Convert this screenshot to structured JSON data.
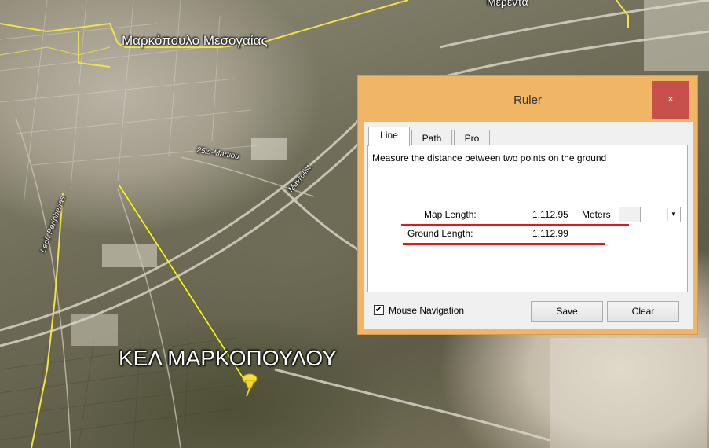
{
  "map": {
    "town_label": "Μαρκόπουλο Μεσογαίας",
    "place_label": "Μερέντα",
    "marker_label": "ΚΕΛ ΜΑΡΚΟΠΟΥΛΟΥ",
    "street_1": "25is-Martiou",
    "street_2": "Mavrolist",
    "street_3": "Leof. Peripherias"
  },
  "ruler": {
    "title": "Ruler",
    "close_icon": "×",
    "tabs": [
      {
        "label": "Line",
        "active": true
      },
      {
        "label": "Path",
        "active": false
      },
      {
        "label": "Pro",
        "active": false
      }
    ],
    "description": "Measure the distance between two points on the ground",
    "map_length_label": "Map Length:",
    "map_length_value": "1,112.95",
    "units_value": "Meters",
    "dropdown_arrow": "▼",
    "ground_length_label": "Ground Length:",
    "ground_length_value": "1,112.99",
    "mouse_navigation_checked": true,
    "checkbox_mark": "✔",
    "mouse_navigation_label": "Mouse Navigation",
    "save_label": "Save",
    "clear_label": "Clear",
    "accent_color": "#f0b565",
    "close_color": "#c9504a",
    "underline_color": "#e8161b"
  }
}
